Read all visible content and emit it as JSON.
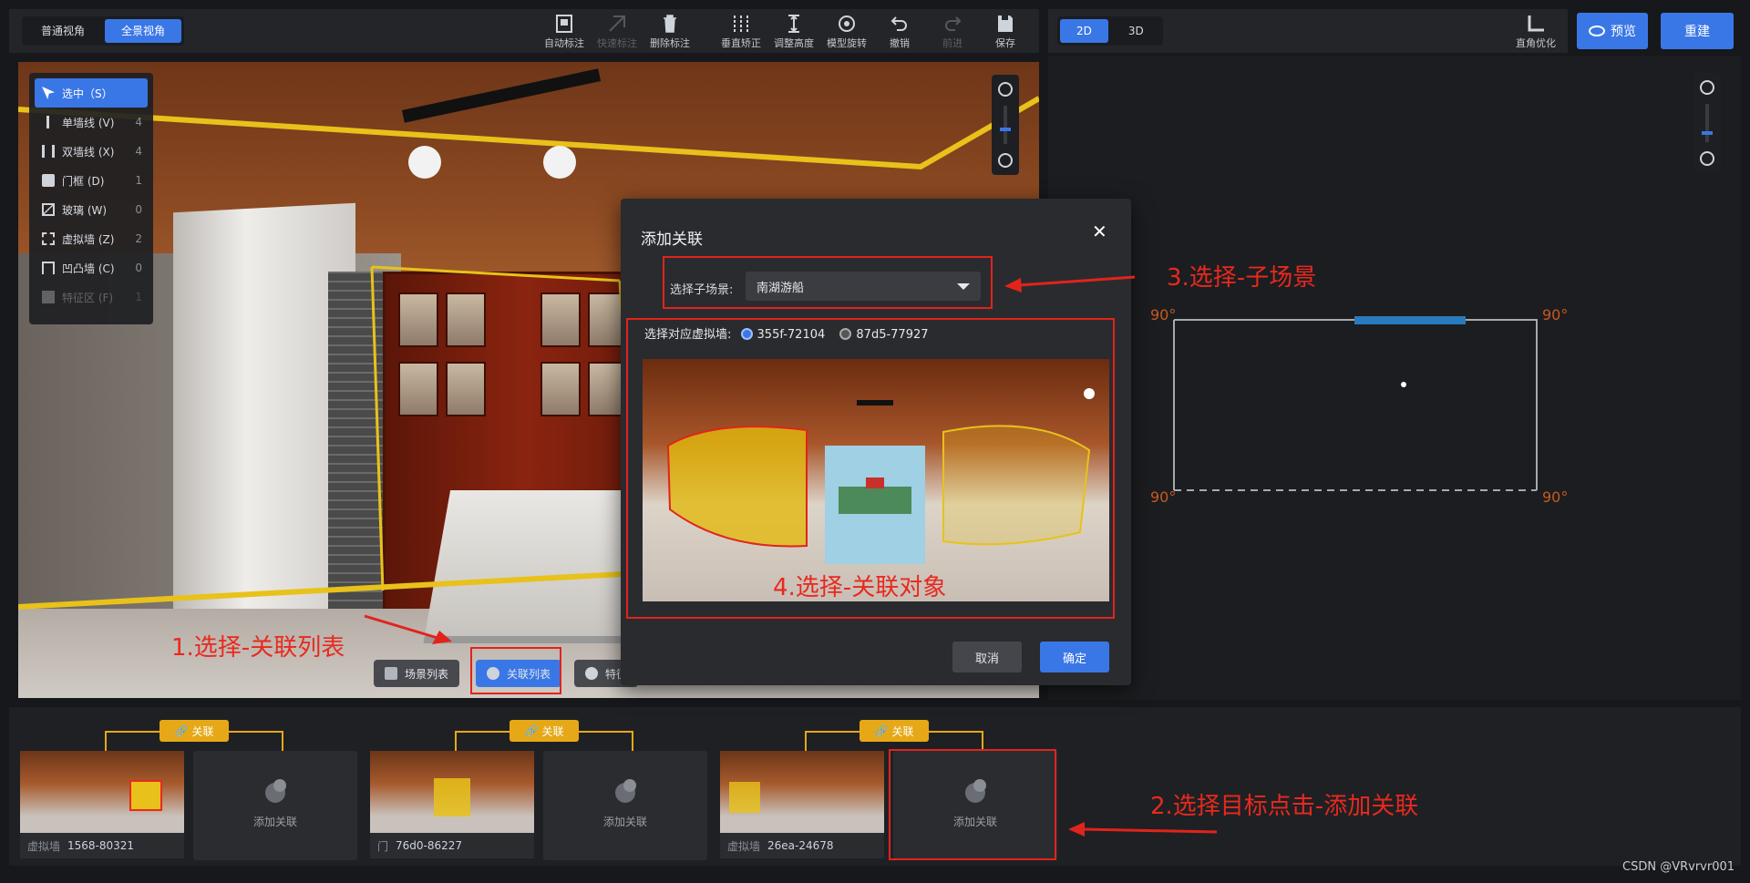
{
  "left_toolbar": {
    "view_modes": [
      "普通视角",
      "全景视角"
    ],
    "active_view_mode": "全景视角",
    "tools": [
      {
        "label": "自动标注",
        "icon": "auto-annotate-icon",
        "enabled": true
      },
      {
        "label": "快速标注",
        "icon": "quick-annotate-icon",
        "enabled": false
      },
      {
        "label": "删除标注",
        "icon": "trash-icon",
        "enabled": true
      },
      {
        "label": "垂直矫正",
        "icon": "vertical-correct-icon",
        "enabled": true
      },
      {
        "label": "调整高度",
        "icon": "height-icon",
        "enabled": true
      },
      {
        "label": "模型旋转",
        "icon": "rotate-icon",
        "enabled": true
      },
      {
        "label": "撤销",
        "icon": "undo-icon",
        "enabled": true
      },
      {
        "label": "前进",
        "icon": "redo-icon",
        "enabled": false
      },
      {
        "label": "保存",
        "icon": "save-icon",
        "enabled": true
      }
    ]
  },
  "palette": {
    "items": [
      {
        "label": "选中（S）",
        "count": "",
        "active": true,
        "icon": "cursor-icon"
      },
      {
        "label": "单墙线 (V)",
        "count": "4",
        "active": false,
        "icon": "single-wall-icon"
      },
      {
        "label": "双墙线 (X)",
        "count": "4",
        "active": false,
        "icon": "double-wall-icon"
      },
      {
        "label": "门框 (D)",
        "count": "1",
        "active": false,
        "icon": "door-icon"
      },
      {
        "label": "玻璃 (W)",
        "count": "0",
        "active": false,
        "icon": "glass-icon"
      },
      {
        "label": "虚拟墙 (Z)",
        "count": "2",
        "active": false,
        "icon": "virtual-wall-icon"
      },
      {
        "label": "凹凸墙 (C)",
        "count": "0",
        "active": false,
        "icon": "bump-wall-icon"
      },
      {
        "label": "特征区 (F)",
        "count": "1",
        "active": false,
        "icon": "feature-area-icon"
      }
    ]
  },
  "viewport_buttons": {
    "scene_list": "场景列表",
    "link_list": "关联列表",
    "feature": "特征"
  },
  "right_toolbar": {
    "modes": [
      "2D",
      "3D"
    ],
    "active_mode": "2D",
    "corner_opt": "直角优化",
    "preview": "预览",
    "rebuild": "重建"
  },
  "plan": {
    "angle_labels": [
      "90°",
      "90°",
      "90°",
      "90°"
    ]
  },
  "modal": {
    "title": "添加关联",
    "close": "✕",
    "scene_label": "选择子场景:",
    "scene_value": "南湖游船",
    "wall_label": "选择对应虚拟墙:",
    "wall_options": [
      {
        "label": "355f-72104",
        "selected": true
      },
      {
        "label": "87d5-77927",
        "selected": false
      }
    ],
    "cancel": "取消",
    "confirm": "确定"
  },
  "links": [
    {
      "tag": "关联",
      "caption_type": "虚拟墙",
      "caption_id": "1568-80321",
      "add_label": "添加关联"
    },
    {
      "tag": "关联",
      "caption_type": "门",
      "caption_id": "76d0-86227",
      "add_label": "添加关联"
    },
    {
      "tag": "关联",
      "caption_type": "虚拟墙",
      "caption_id": "26ea-24678",
      "add_label": "添加关联"
    }
  ],
  "annotations": {
    "step1": "1.选择-关联列表",
    "step2": "2.选择目标点击-添加关联",
    "step3": "3.选择-子场景",
    "step4": "4.选择-关联对象"
  },
  "watermark": "CSDN @VRvrvr001",
  "colors": {
    "accent": "#3a77e6",
    "annotation": "#e0241b",
    "tag": "#e6a817",
    "highlight_blue": "#2a7bbd"
  }
}
